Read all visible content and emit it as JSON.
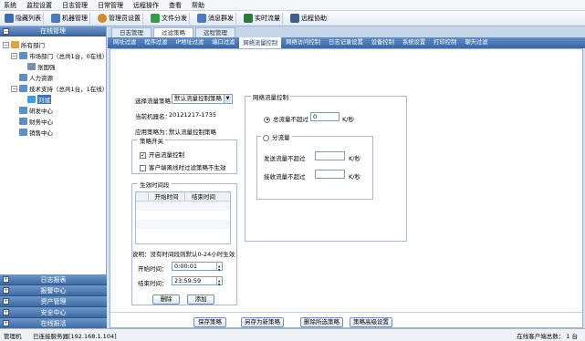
{
  "menu": [
    "系统",
    "监控设置",
    "日志管理",
    "日常管理",
    "远程操作",
    "查看",
    "帮助"
  ],
  "toolbar": [
    {
      "label": "隐藏列表",
      "icon": "list-icon",
      "color": "#3d6fb0"
    },
    {
      "label": "机器管理",
      "icon": "computer-icon",
      "color": "#4a7ab8"
    },
    {
      "label": "管理员设置",
      "icon": "admin-icon",
      "color": "#d08a2a"
    },
    {
      "label": "文件分发",
      "icon": "file-icon",
      "color": "#3a9a4a"
    },
    {
      "label": "消息群发",
      "icon": "message-icon",
      "color": "#4a7ab8"
    },
    {
      "label": "实时流量",
      "icon": "traffic-icon",
      "color": "#2a7a3a"
    },
    {
      "label": "远程协助",
      "icon": "remote-icon",
      "color": "#3d5f90"
    }
  ],
  "left": {
    "header": "在线管理",
    "tree": [
      {
        "label": "所有部门"
      },
      {
        "label": "市场部门（总共1台，0在线）"
      },
      {
        "label": "张国强"
      },
      {
        "label": "人力资源"
      },
      {
        "label": "技术支持（总共1台，1在线）"
      },
      {
        "label": "刘斌"
      },
      {
        "label": "研发中心"
      },
      {
        "label": "财务中心"
      },
      {
        "label": "销售中心"
      }
    ],
    "bottom": [
      "日志报表",
      "报警中心",
      "资产管理",
      "安全中心",
      "在线报活"
    ]
  },
  "tabs_top": [
    "日志管理",
    "过滤策略",
    "远程管理"
  ],
  "tabs_sub": [
    "网址过滤",
    "程序过滤",
    "IP地址过滤",
    "端口过滤",
    "网络流量控制",
    "网络访问控制",
    "日志记录设置",
    "设备控制",
    "系统设置",
    "打印控制",
    "聊天过滤"
  ],
  "form": {
    "select_policy_label": "选择流量策略",
    "select_policy_value": "默认流量控制策略",
    "machine_name_label": "当前机器名：",
    "machine_name_value": "20121217-1735",
    "applied_policy_label": "应用策略为：",
    "applied_policy_value": "默认流量控制策略",
    "switch_group": "策略开关",
    "enable_label": "开启流量控制",
    "offline_label": "客户端离线时过滤策略不生效",
    "time_group": "生效时间段",
    "col_start": "开始时间",
    "col_end": "结束时间",
    "note": "说明：没有时间段则默认0-24小时生效",
    "start_time_label": "开始时间：",
    "start_time_value": "0:00:01",
    "end_time_label": "结束时间：",
    "end_time_value": "23:59:59",
    "delete_btn": "删除",
    "add_btn": "添加",
    "net_group": "网络流量控制",
    "total_label": "总流量不超过",
    "total_value": "0",
    "unit": "K/秒",
    "split_label": "分流量",
    "send_label": "发送流量不超过",
    "recv_label": "接收流量不超过",
    "save_btn": "保存策略",
    "save_as_btn": "另存为新策略",
    "delete_policy_btn": "删除所选策略",
    "advanced_btn": "策略高级设置"
  },
  "status": {
    "left": "管理机",
    "server": "已连接服务器[192.168.1.104]",
    "online_label": "在线客户端总数：",
    "online_value": "1 台"
  }
}
